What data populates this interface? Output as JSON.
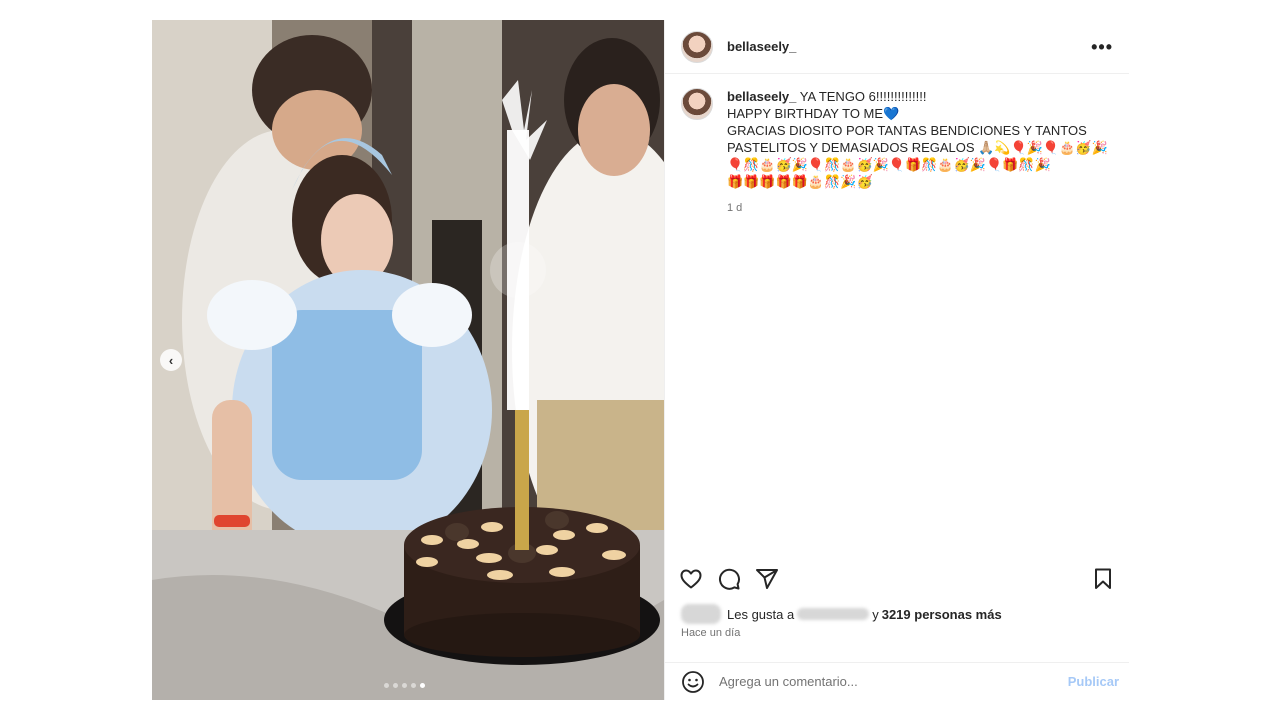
{
  "post": {
    "username": "bellaseely_",
    "more_label": "•••",
    "caption": {
      "username": "bellaseely_",
      "line1": "YA TENGO 6!!!!!!!!!!!!!!",
      "line2": "HAPPY BIRTHDAY TO ME💙",
      "line3": "GRACIAS DIOSITO POR TANTAS BENDICIONES Y TANTOS",
      "line4": "PASTELITOS Y DEMASIADOS REGALOS 🙏🏼💫🎈🎉🎈🎂🥳🎉",
      "line5": "🎈🎊🎂🥳🎉🎈🎊🎂🥳🎉🎈🎁🎊🎂🥳🎉🎈🎁🎊🎉",
      "line6": "🎁🎁🎁🎁🎁🎂🎊🎉🥳",
      "time": "1 d"
    },
    "likes": {
      "prefix": "Les gusta a",
      "conjunction": "y",
      "count_text": "3219 personas más"
    },
    "posted_ago": "Hace un día",
    "comment": {
      "placeholder": "Agrega un comentario...",
      "publish_label": "Publicar"
    },
    "carousel": {
      "prev_label": "‹",
      "total_slides": 5,
      "active_slide": 5
    }
  }
}
